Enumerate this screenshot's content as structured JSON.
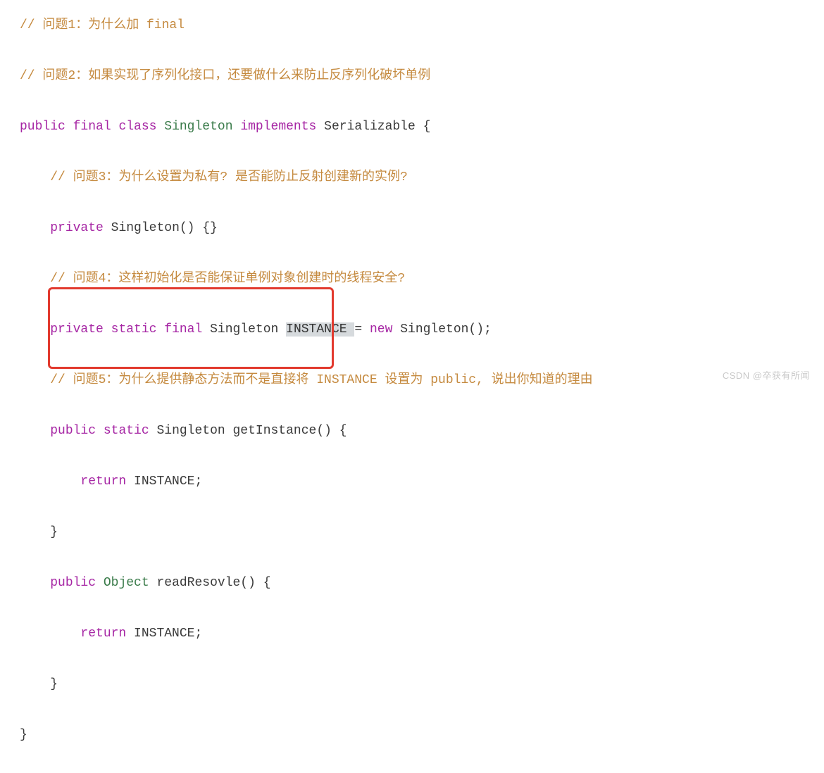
{
  "code": {
    "c1": "// 问题1：为什么加 final",
    "c2": "// 问题2：如果实现了序列化接口，还要做什么来防止反序列化破坏单例",
    "kw_public": "public",
    "kw_final": "final",
    "kw_class": "class",
    "kw_implements": "implements",
    "kw_private": "private",
    "kw_static": "static",
    "kw_new": "new",
    "kw_return": "return",
    "type_Singleton": "Singleton",
    "type_Serializable": "Serializable",
    "type_Object": "Object",
    "c3": "// 问题3：为什么设置为私有? 是否能防止反射创建新的实例?",
    "c4": "// 问题4：这样初始化是否能保证单例对象创建时的线程安全?",
    "c5": "// 问题5：为什么提供静态方法而不是直接将 INSTANCE 设置为 public, 说出你知道的理由",
    "id_INSTANCE": "INSTANCE",
    "id_getInstance": "getInstance",
    "id_readResovle": "readResovle",
    "ctor_sig": "Singleton() {}",
    "brace_open": "{",
    "brace_close": "}",
    "paren_empty": "()",
    "eq": "=",
    "semi": ";",
    "instance_new_tail": "Singleton();"
  },
  "watermark": "CSDN @卒获有所闻"
}
